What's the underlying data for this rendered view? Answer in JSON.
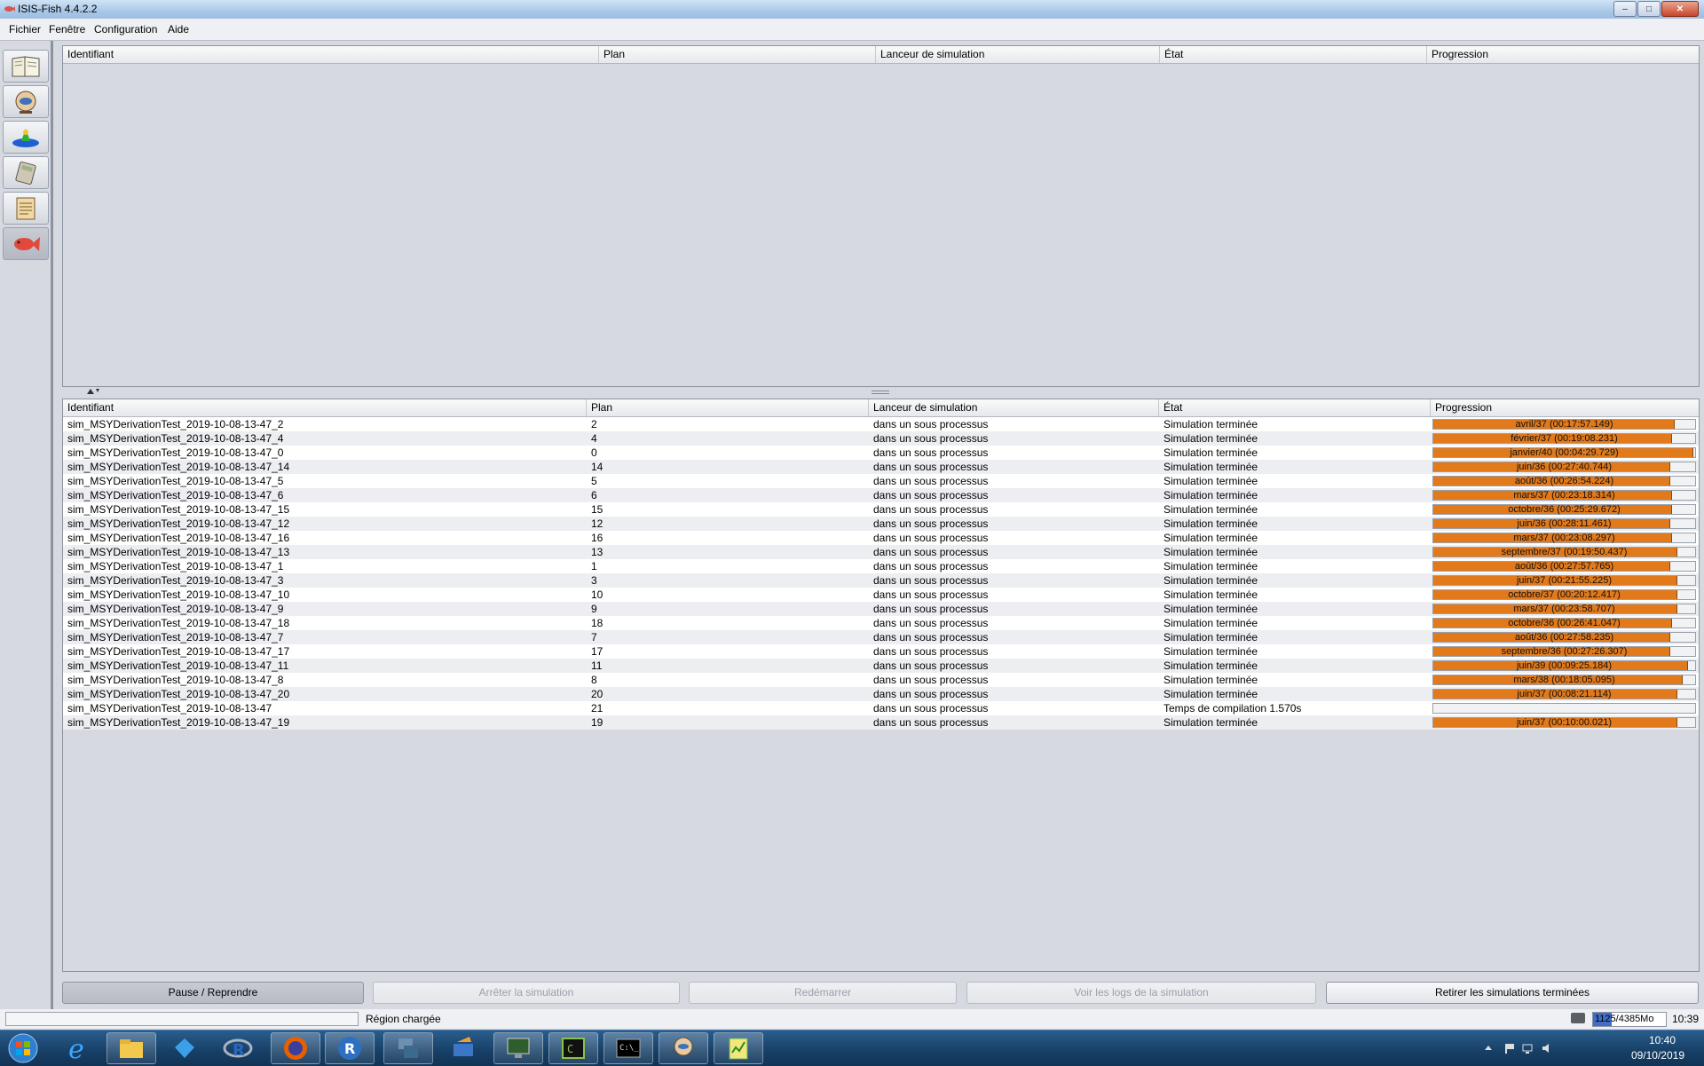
{
  "window": {
    "title": "ISIS-Fish 4.4.2.2"
  },
  "menu": [
    "Fichier",
    "Fenêtre",
    "Configuration",
    "Aide"
  ],
  "left_toolbar": [
    {
      "icon": "book-icon"
    },
    {
      "icon": "fish-globe-icon"
    },
    {
      "icon": "water-chart-icon"
    },
    {
      "icon": "calculator-icon"
    },
    {
      "icon": "document-icon"
    },
    {
      "icon": "red-fish-icon"
    }
  ],
  "top_table": {
    "columns": [
      "Identifiant",
      "Plan",
      "Lanceur de simulation",
      "État",
      "Progression"
    ]
  },
  "bottom_table": {
    "columns": [
      "Identifiant",
      "Plan",
      "Lanceur de simulation",
      "État",
      "Progression"
    ],
    "rows": [
      {
        "id": "sim_MSYDerivationTest_2019-10-08-13-47_2",
        "plan": "2",
        "launcher": "dans un sous processus",
        "state": "Simulation terminée",
        "progress_text": "avril/37 (00:17:57.149)",
        "progress": 0.92
      },
      {
        "id": "sim_MSYDerivationTest_2019-10-08-13-47_4",
        "plan": "4",
        "launcher": "dans un sous processus",
        "state": "Simulation terminée",
        "progress_text": "février/37 (00:19:08.231)",
        "progress": 0.91
      },
      {
        "id": "sim_MSYDerivationTest_2019-10-08-13-47_0",
        "plan": "0",
        "launcher": "dans un sous processus",
        "state": "Simulation terminée",
        "progress_text": "janvier/40 (00:04:29.729)",
        "progress": 0.99
      },
      {
        "id": "sim_MSYDerivationTest_2019-10-08-13-47_14",
        "plan": "14",
        "launcher": "dans un sous processus",
        "state": "Simulation terminée",
        "progress_text": "juin/36 (00:27:40.744)",
        "progress": 0.9
      },
      {
        "id": "sim_MSYDerivationTest_2019-10-08-13-47_5",
        "plan": "5",
        "launcher": "dans un sous processus",
        "state": "Simulation terminée",
        "progress_text": "août/36 (00:26:54.224)",
        "progress": 0.9
      },
      {
        "id": "sim_MSYDerivationTest_2019-10-08-13-47_6",
        "plan": "6",
        "launcher": "dans un sous processus",
        "state": "Simulation terminée",
        "progress_text": "mars/37 (00:23:18.314)",
        "progress": 0.91
      },
      {
        "id": "sim_MSYDerivationTest_2019-10-08-13-47_15",
        "plan": "15",
        "launcher": "dans un sous processus",
        "state": "Simulation terminée",
        "progress_text": "octobre/36 (00:25:29.672)",
        "progress": 0.91
      },
      {
        "id": "sim_MSYDerivationTest_2019-10-08-13-47_12",
        "plan": "12",
        "launcher": "dans un sous processus",
        "state": "Simulation terminée",
        "progress_text": "juin/36 (00:28:11.461)",
        "progress": 0.9
      },
      {
        "id": "sim_MSYDerivationTest_2019-10-08-13-47_16",
        "plan": "16",
        "launcher": "dans un sous processus",
        "state": "Simulation terminée",
        "progress_text": "mars/37 (00:23:08.297)",
        "progress": 0.91
      },
      {
        "id": "sim_MSYDerivationTest_2019-10-08-13-47_13",
        "plan": "13",
        "launcher": "dans un sous processus",
        "state": "Simulation terminée",
        "progress_text": "septembre/37 (00:19:50.437)",
        "progress": 0.93
      },
      {
        "id": "sim_MSYDerivationTest_2019-10-08-13-47_1",
        "plan": "1",
        "launcher": "dans un sous processus",
        "state": "Simulation terminée",
        "progress_text": "août/36 (00:27:57.765)",
        "progress": 0.9
      },
      {
        "id": "sim_MSYDerivationTest_2019-10-08-13-47_3",
        "plan": "3",
        "launcher": "dans un sous processus",
        "state": "Simulation terminée",
        "progress_text": "juin/37 (00:21:55.225)",
        "progress": 0.93
      },
      {
        "id": "sim_MSYDerivationTest_2019-10-08-13-47_10",
        "plan": "10",
        "launcher": "dans un sous processus",
        "state": "Simulation terminée",
        "progress_text": "octobre/37 (00:20:12.417)",
        "progress": 0.93
      },
      {
        "id": "sim_MSYDerivationTest_2019-10-08-13-47_9",
        "plan": "9",
        "launcher": "dans un sous processus",
        "state": "Simulation terminée",
        "progress_text": "mars/37 (00:23:58.707)",
        "progress": 0.93
      },
      {
        "id": "sim_MSYDerivationTest_2019-10-08-13-47_18",
        "plan": "18",
        "launcher": "dans un sous processus",
        "state": "Simulation terminée",
        "progress_text": "octobre/36 (00:26:41.047)",
        "progress": 0.91
      },
      {
        "id": "sim_MSYDerivationTest_2019-10-08-13-47_7",
        "plan": "7",
        "launcher": "dans un sous processus",
        "state": "Simulation terminée",
        "progress_text": "août/36 (00:27:58.235)",
        "progress": 0.9
      },
      {
        "id": "sim_MSYDerivationTest_2019-10-08-13-47_17",
        "plan": "17",
        "launcher": "dans un sous processus",
        "state": "Simulation terminée",
        "progress_text": "septembre/36 (00:27:26.307)",
        "progress": 0.9
      },
      {
        "id": "sim_MSYDerivationTest_2019-10-08-13-47_11",
        "plan": "11",
        "launcher": "dans un sous processus",
        "state": "Simulation terminée",
        "progress_text": "juin/39 (00:09:25.184)",
        "progress": 0.97
      },
      {
        "id": "sim_MSYDerivationTest_2019-10-08-13-47_8",
        "plan": "8",
        "launcher": "dans un sous processus",
        "state": "Simulation terminée",
        "progress_text": "mars/38 (00:18:05.095)",
        "progress": 0.95
      },
      {
        "id": "sim_MSYDerivationTest_2019-10-08-13-47_20",
        "plan": "20",
        "launcher": "dans un sous processus",
        "state": "Simulation terminée",
        "progress_text": "juin/37 (00:08:21.114)",
        "progress": 0.93
      },
      {
        "id": "sim_MSYDerivationTest_2019-10-08-13-47",
        "plan": "21",
        "launcher": "dans un sous processus",
        "state": "Temps de compilation 1.570s",
        "progress_text": "",
        "progress": 0
      },
      {
        "id": "sim_MSYDerivationTest_2019-10-08-13-47_19",
        "plan": "19",
        "launcher": "dans un sous processus",
        "state": "Simulation terminée",
        "progress_text": "juin/37 (00:10:00.021)",
        "progress": 0.93
      }
    ]
  },
  "buttons": {
    "pause": "Pause / Reprendre",
    "stop": "Arrêter la simulation",
    "restart": "Redémarrer",
    "logs": "Voir les logs de la simulation",
    "remove": "Retirer les simulations terminées"
  },
  "status": {
    "text": "Région chargée",
    "memory": "1125/4385Mo",
    "memory_fraction": 0.26,
    "time": "10:39"
  },
  "taskbar": {
    "apps": [
      "internet-explorer-icon",
      "file-explorer-icon",
      "tortoise-icon",
      "r-studio-icon",
      "firefox-icon",
      "r-icon",
      "network-icon",
      "remote-icon",
      "monitor-icon",
      "console-icon",
      "terminal-icon",
      "isis-fish-icon",
      "notepad-icon"
    ],
    "clock_time": "10:40",
    "clock_date": "09/10/2019"
  },
  "colors": {
    "progress_fill": "#e27a1b",
    "taskbar": "#173f66"
  }
}
